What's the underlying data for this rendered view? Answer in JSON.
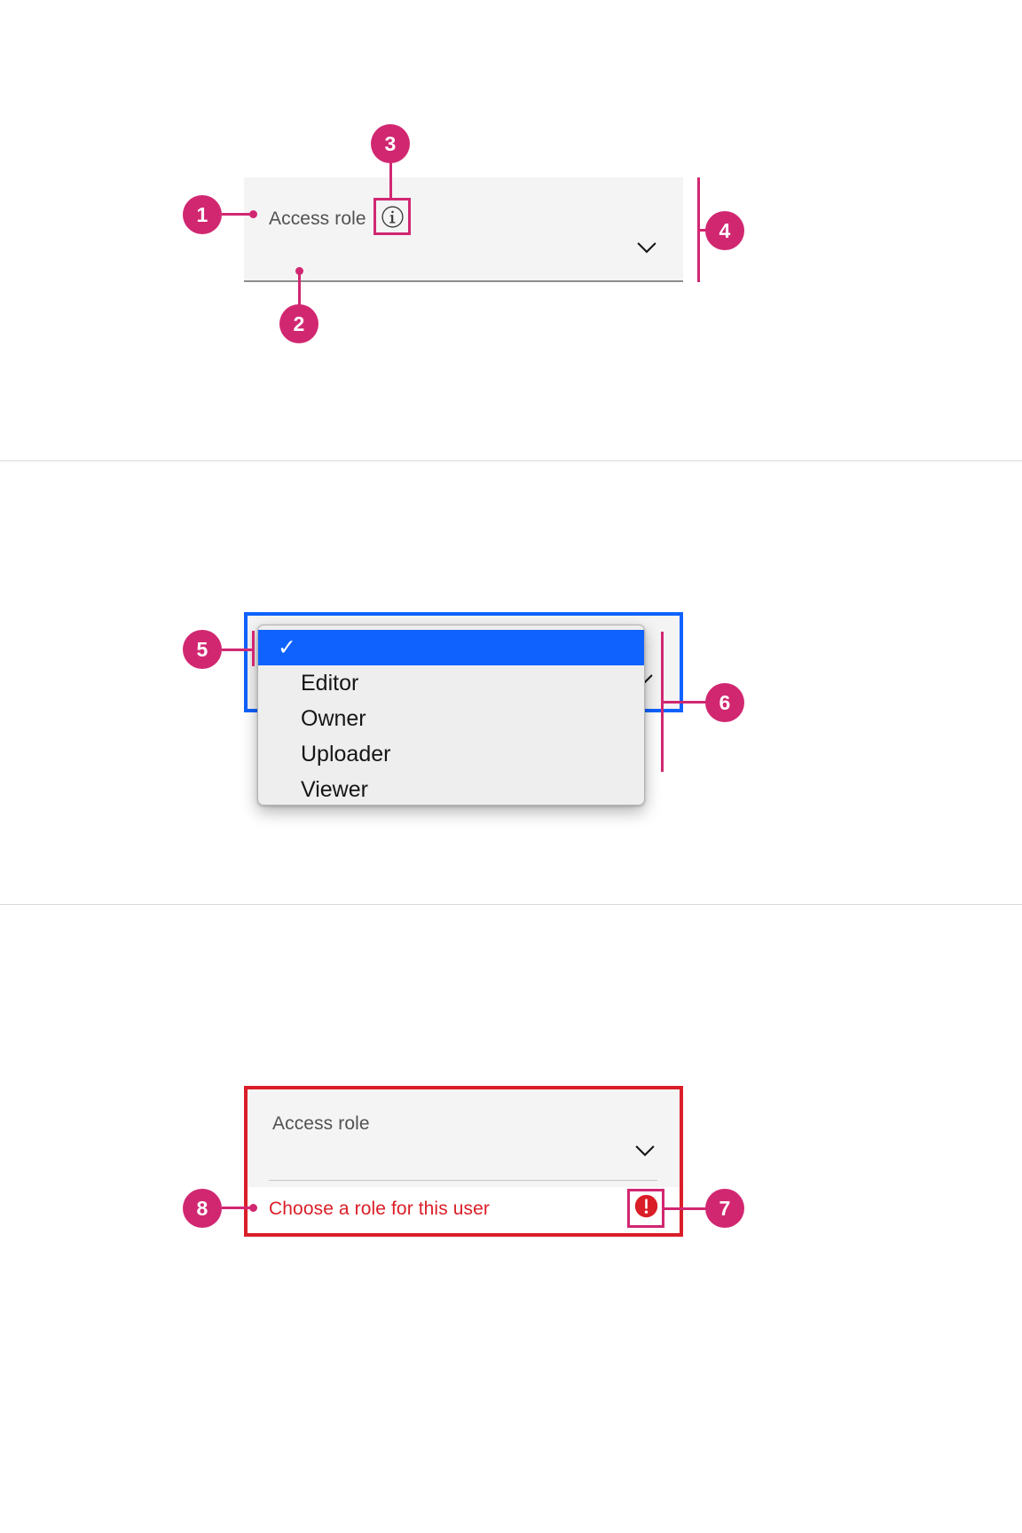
{
  "page": {
    "title": "Dropdown component anatomy",
    "colors": {
      "annotation_pink": "#d12771",
      "field_background": "#f4f4f4",
      "focus_blue": "#0f62fe",
      "error_red": "#da1e28",
      "menu_highlight": "#0f62fe",
      "label_gray": "#525252",
      "underline_gray": "#8d8d8d",
      "divider_gray": "#d9d9d9"
    }
  },
  "sections": {
    "default_state": {
      "label": "Access role",
      "helper_icon": "information-icon",
      "chevron_icon": "chevron-down-icon",
      "callouts": [
        {
          "number": "1",
          "target": "field-label"
        },
        {
          "number": "2",
          "target": "field-underline"
        },
        {
          "number": "3",
          "target": "information-icon"
        },
        {
          "number": "4",
          "target": "field-container"
        }
      ]
    },
    "open_state": {
      "chevron_icon": "chevron-down-icon",
      "menu": {
        "selected_index": 0,
        "check_glyph": "✓",
        "items": [
          {
            "label": "",
            "selected": true
          },
          {
            "label": "Editor",
            "selected": false
          },
          {
            "label": "Owner",
            "selected": false
          },
          {
            "label": "Uploader",
            "selected": false
          },
          {
            "label": "Viewer",
            "selected": false
          }
        ]
      },
      "callouts": [
        {
          "number": "5",
          "target": "menu-selected-item"
        },
        {
          "number": "6",
          "target": "menu-container"
        }
      ]
    },
    "invalid_state": {
      "label": "Access role",
      "chevron_icon": "chevron-down-icon",
      "error_message": "Choose a role for this user",
      "error_icon": "error-filled-icon",
      "callouts": [
        {
          "number": "7",
          "target": "error-icon"
        },
        {
          "number": "8",
          "target": "error-message"
        }
      ]
    }
  }
}
